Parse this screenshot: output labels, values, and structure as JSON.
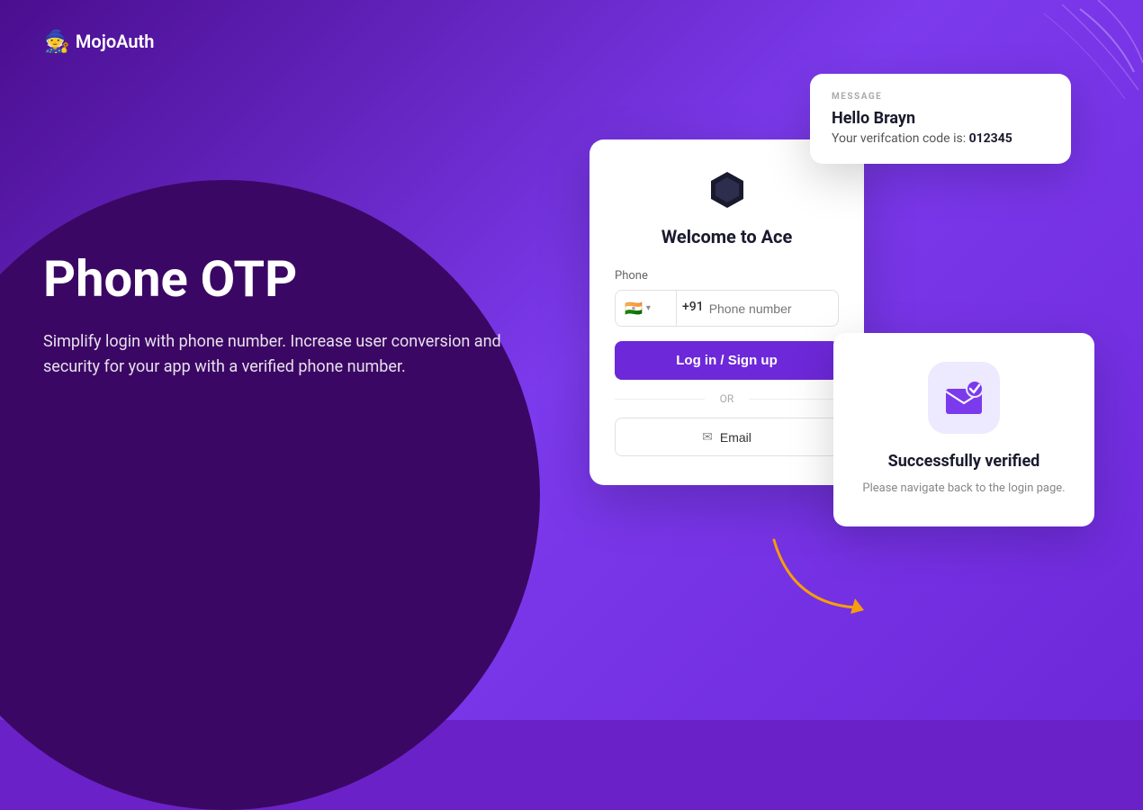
{
  "brand": {
    "name": "MojoAuth",
    "logo_icon": "🧙"
  },
  "hero": {
    "title": "Phone OTP",
    "description": "Simplify login with phone number. Increase user conversion and security for your app with a verified phone number."
  },
  "login_card": {
    "welcome_text": "Welcome to Ace",
    "phone_label": "Phone",
    "country_flag": "🇮🇳",
    "country_code": "+91",
    "phone_placeholder": "Phone number",
    "login_button": "Log in / Sign up",
    "or_text": "OR",
    "email_button": "Email"
  },
  "message_card": {
    "label": "MESSAGE",
    "greeting": "Hello Brayn",
    "body_prefix": "Your verifcation code is:",
    "code": "012345"
  },
  "success_card": {
    "title": "Successfully verified",
    "description": "Please navigate back to the login page."
  }
}
